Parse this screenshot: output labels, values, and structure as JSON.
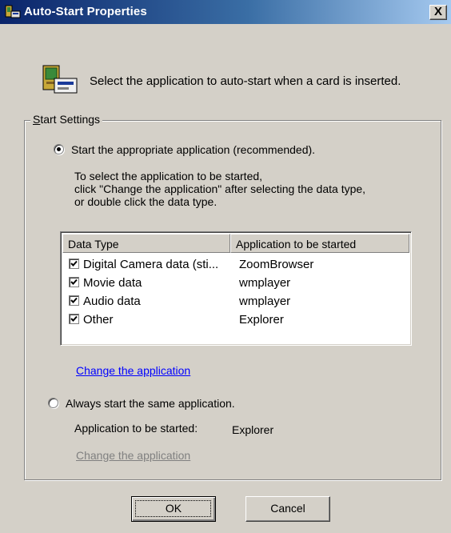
{
  "window": {
    "title": "Auto-Start Properties",
    "close_label": "X"
  },
  "header": {
    "text": "Select the application to auto-start when a card is inserted."
  },
  "group": {
    "label_prefix": "S",
    "label_rest": "tart Settings"
  },
  "option_auto": {
    "label": "Start the appropriate application (recommended).",
    "selected": true,
    "help_line1": "To select the application to be started,",
    "help_line2": "click \"Change the application\" after selecting the data type,",
    "help_line3": "or double click the data type."
  },
  "table": {
    "columns": [
      "Data Type",
      "Application to be started"
    ],
    "rows": [
      {
        "type": "Digital Camera data (sti...",
        "app": "ZoomBrowser",
        "checked": true
      },
      {
        "type": "Movie data",
        "app": "wmplayer",
        "checked": true
      },
      {
        "type": "Audio data",
        "app": "wmplayer",
        "checked": true
      },
      {
        "type": "Other",
        "app": "Explorer",
        "checked": true
      }
    ]
  },
  "change_link_1": "Change the application",
  "option_same": {
    "label": "Always start the same application.",
    "selected": false,
    "app_label": "Application to be started:",
    "app_value": "Explorer"
  },
  "change_link_2": "Change the application",
  "buttons": {
    "ok": "OK",
    "cancel": "Cancel"
  },
  "colors": {
    "face": "#d4d0c8",
    "title_start": "#0a246a",
    "title_end": "#a6caf0",
    "link": "#0000ff"
  }
}
